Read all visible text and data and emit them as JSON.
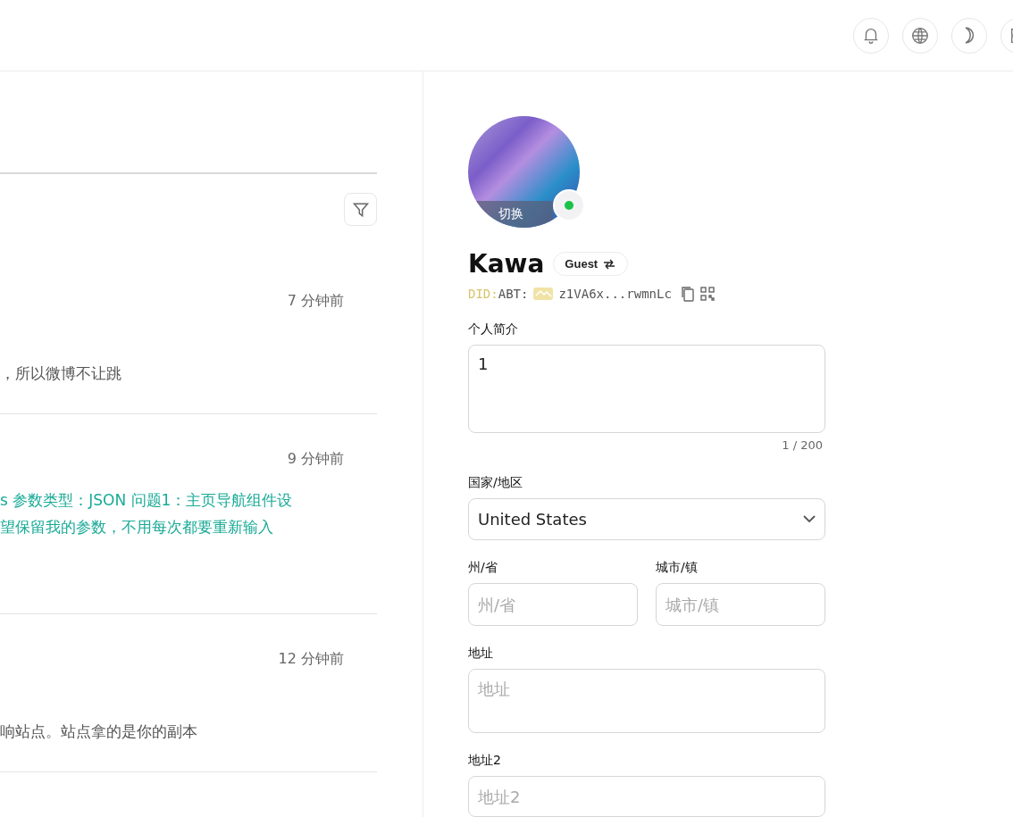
{
  "feed": {
    "items": [
      {
        "time": "7 分钟前",
        "kind": "comment",
        "lines": [
          "，所以微博不让跳"
        ]
      },
      {
        "time": "9 分钟前",
        "kind": "link",
        "lines": [
          "s 参数类型：JSON 问题1：主页导航组件设",
          "望保留我的参数，不用每次都要重新输入"
        ]
      },
      {
        "time": "12 分钟前",
        "kind": "comment",
        "lines": [
          "响站点。站点拿的是你的副本"
        ]
      }
    ]
  },
  "profile": {
    "switch_label": "切换",
    "online": true,
    "name": "Kawa",
    "role": "Guest",
    "did": {
      "prefix": "DID:",
      "chain": "ABT:",
      "address": "z1VA6x...rwmnLc"
    }
  },
  "form": {
    "bio": {
      "label": "个人简介",
      "value": "1",
      "counter": "1 / 200"
    },
    "country": {
      "label": "国家/地区",
      "value": "United States"
    },
    "state": {
      "label": "州/省",
      "placeholder": "州/省"
    },
    "city": {
      "label": "城市/镇",
      "placeholder": "城市/镇"
    },
    "address": {
      "label": "地址",
      "placeholder": "地址"
    },
    "address2": {
      "label": "地址2",
      "placeholder": "地址2"
    }
  }
}
